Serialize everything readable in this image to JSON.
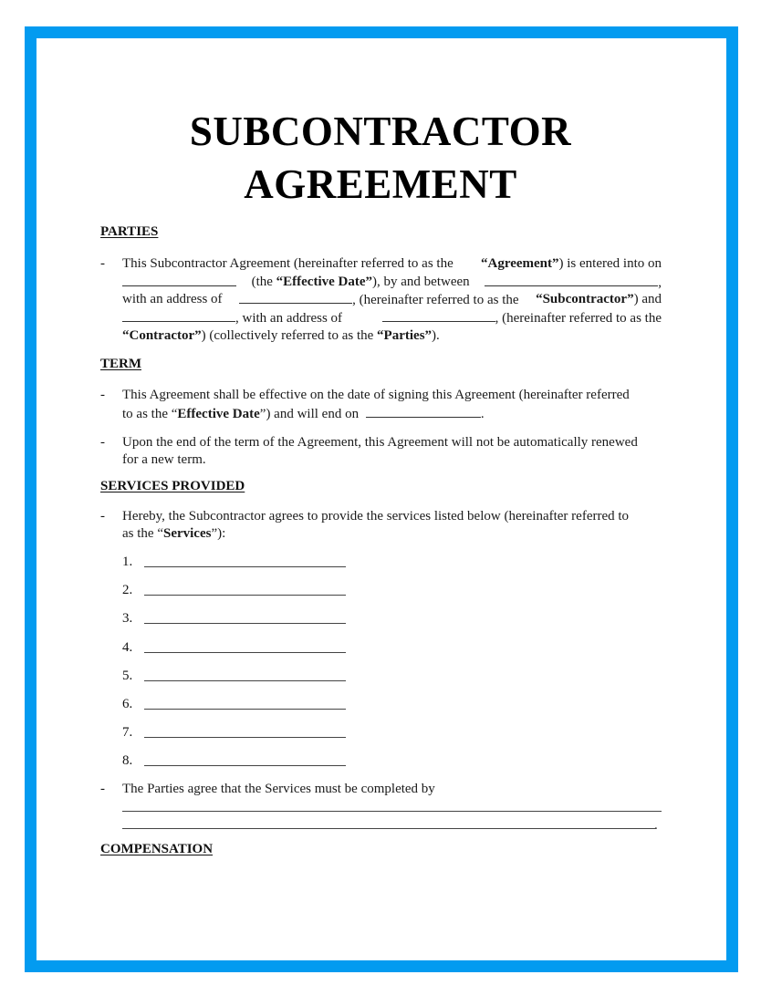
{
  "document": {
    "title_line1": "SUBCONTRACTOR",
    "title_line2": "AGREEMENT",
    "border_color": "#039bf0"
  },
  "parties": {
    "heading": "PARTIES",
    "bullet": "-",
    "l1a": "This Subcontractor Agreement (hereinafter referred to as the",
    "l1b": "“Agreement”",
    "l1c": ") is entered into on",
    "l2a": "(the",
    "l2b": "“Effective Date”",
    "l2c": "), by and between",
    "l2d": ",",
    "l3a": "with an address of",
    "l3b": ", (hereinafter referred to as the",
    "l3c": "“Subcontractor”",
    "l3d": ") and",
    "l4a": ", with an address of",
    "l4b": ", (hereinafter referred to as the",
    "l5a": "“Contractor”",
    "l5b": ") (collectively referred to as the",
    "l5c": "“Parties”",
    "l5d": ")."
  },
  "term": {
    "heading": "TERM",
    "bullet": "-",
    "p1_l1": "This Agreement shall be effective on the date of signing this Agreement (hereinafter referred",
    "p1_l2a": "to as the “",
    "p1_l2b": "Effective Date",
    "p1_l2c": "”) and will end on",
    "p1_l2d": ".",
    "p2_l1": "Upon the end of the term of the Agreement, this Agreement will not be automatically renewed",
    "p2_l2": "for a new term."
  },
  "services": {
    "heading": "SERVICES PROVIDED",
    "bullet": "-",
    "p1_l1": "Hereby, the Subcontractor agrees to provide the services listed below (hereinafter referred to",
    "p1_l2a": "as the “",
    "p1_l2b": "Services",
    "p1_l2c": "”):",
    "items": [
      "1.",
      "2.",
      "3.",
      "4.",
      "5.",
      "6.",
      "7.",
      "8."
    ],
    "p2": "The Parties agree that the Services must be completed by",
    "p2_end": "."
  },
  "compensation": {
    "heading": "COMPENSATION"
  }
}
